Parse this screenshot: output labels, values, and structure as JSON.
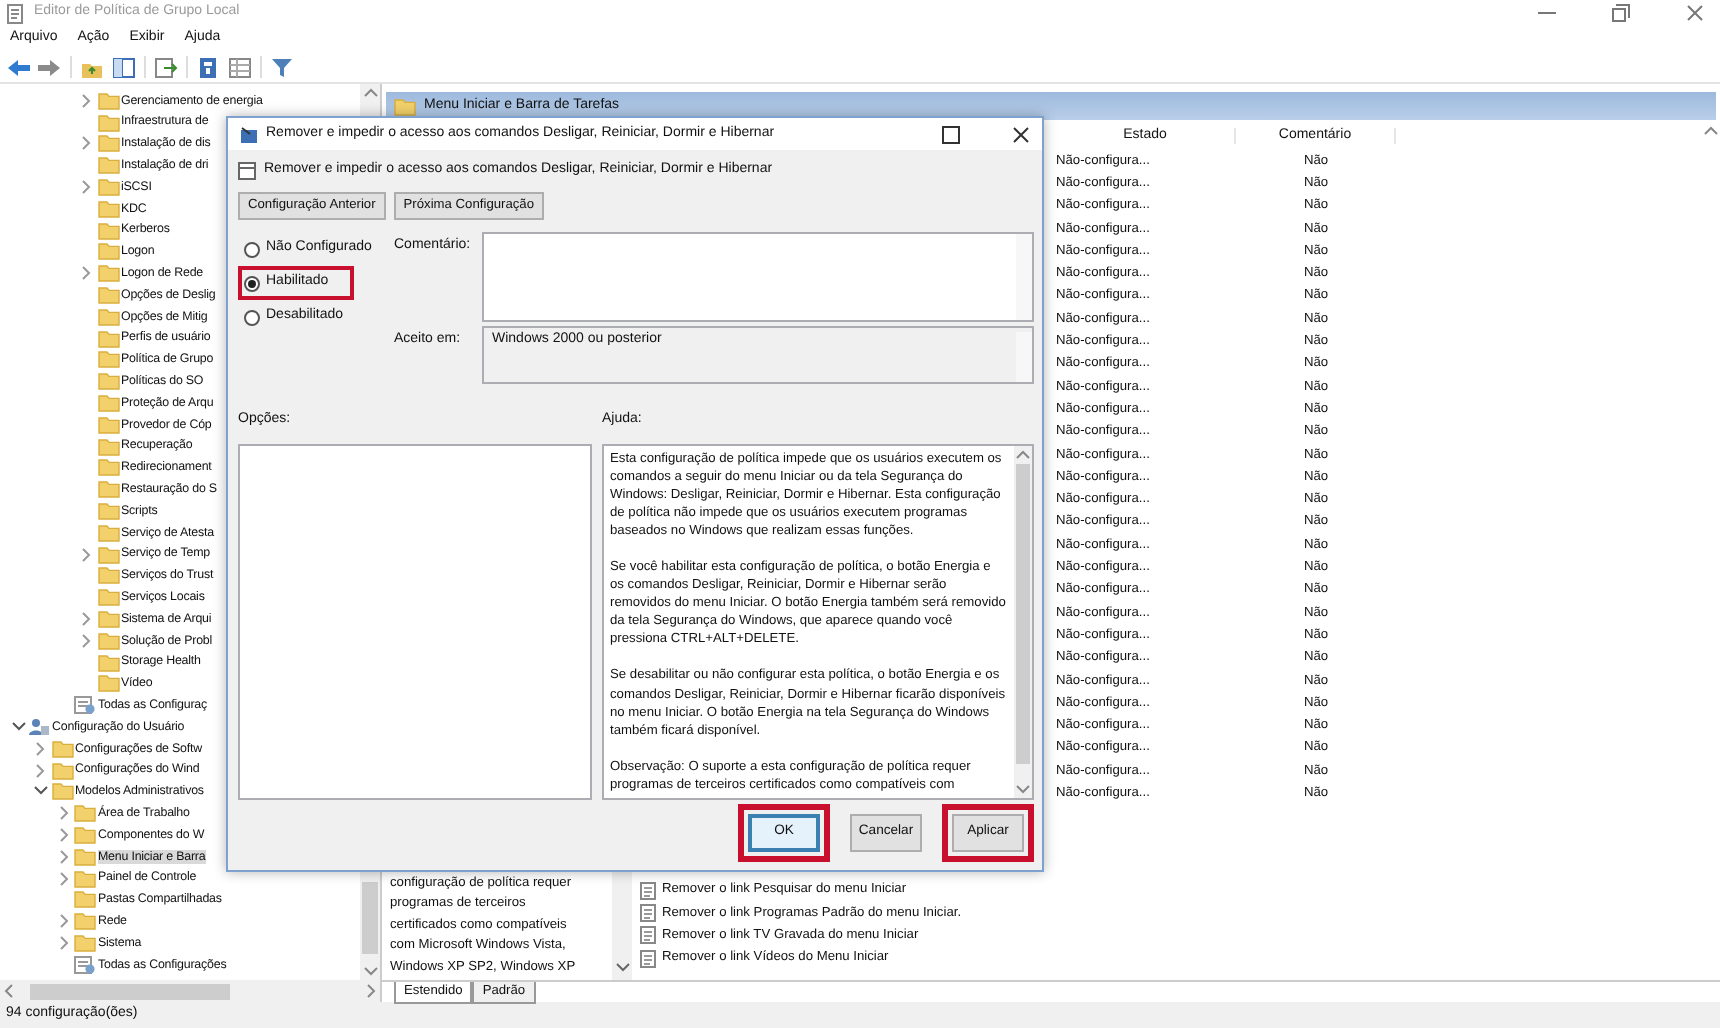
{
  "window": {
    "title": "Editor de Política de Grupo Local"
  },
  "menu": [
    "Arquivo",
    "Ação",
    "Exibir",
    "Ajuda"
  ],
  "tree": {
    "items": [
      {
        "children": [
          {
            "children": [
              {
                "children": [
                  {
                    "label": "Gerenciamento de energia",
                    "kind": "folder",
                    "expanded": false,
                    "selected": false
                  },
                  {
                    "label": "Infraestrutura de",
                    "kind": "folder",
                    "selected": false
                  },
                  {
                    "label": "Instalação de dis",
                    "kind": "folder",
                    "expanded": false,
                    "selected": false
                  },
                  {
                    "label": "Instalação de dri",
                    "kind": "folder",
                    "selected": false
                  },
                  {
                    "label": "iSCSI",
                    "kind": "folder",
                    "expanded": false,
                    "selected": false
                  },
                  {
                    "label": "KDC",
                    "kind": "folder",
                    "selected": false
                  },
                  {
                    "label": "Kerberos",
                    "kind": "folder",
                    "selected": false
                  },
                  {
                    "label": "Logon",
                    "kind": "folder",
                    "selected": false
                  },
                  {
                    "label": "Logon de Rede",
                    "kind": "folder",
                    "expanded": false,
                    "selected": false
                  },
                  {
                    "label": "Opções de Deslig",
                    "kind": "folder",
                    "selected": false
                  },
                  {
                    "label": "Opções de Mitig",
                    "kind": "folder",
                    "selected": false
                  },
                  {
                    "label": "Perfis de usuário",
                    "kind": "folder",
                    "selected": false
                  },
                  {
                    "label": "Política de Grupo",
                    "kind": "folder",
                    "selected": false
                  },
                  {
                    "label": "Políticas do SO",
                    "kind": "folder",
                    "selected": false
                  },
                  {
                    "label": "Proteção de Arqu",
                    "kind": "folder",
                    "selected": false
                  },
                  {
                    "label": "Provedor de Cóp",
                    "kind": "folder",
                    "selected": false
                  },
                  {
                    "label": "Recuperação",
                    "kind": "folder",
                    "selected": false
                  },
                  {
                    "label": "Redirecionament",
                    "kind": "folder",
                    "selected": false
                  },
                  {
                    "label": "Restauração do S",
                    "kind": "folder",
                    "selected": false
                  },
                  {
                    "label": "Scripts",
                    "kind": "folder",
                    "selected": false
                  },
                  {
                    "label": "Serviço de Atesta",
                    "kind": "folder",
                    "selected": false
                  },
                  {
                    "label": "Serviço de Temp",
                    "kind": "folder",
                    "expanded": false,
                    "selected": false
                  },
                  {
                    "label": "Serviços do Trust",
                    "kind": "folder",
                    "selected": false
                  },
                  {
                    "label": "Serviços Locais",
                    "kind": "folder",
                    "selected": false
                  },
                  {
                    "label": "Sistema de Arqui",
                    "kind": "folder",
                    "expanded": false,
                    "selected": false
                  },
                  {
                    "label": "Solução de Probl",
                    "kind": "folder",
                    "expanded": false,
                    "selected": false
                  },
                  {
                    "label": "Storage Health",
                    "kind": "folder",
                    "selected": false
                  },
                  {
                    "label": "Vídeo",
                    "kind": "folder",
                    "selected": false
                  }
                ]
              },
              {
                "label": "Todas as Configuraç",
                "kind": "settings",
                "selected": false
              }
            ]
          }
        ]
      },
      {
        "label": "Configuração do Usuário",
        "kind": "user",
        "expanded": true,
        "selected": false,
        "children": [
          {
            "label": "Configurações de Softw",
            "kind": "folder",
            "expanded": false,
            "selected": false
          },
          {
            "label": "Configurações do Wind",
            "kind": "folder",
            "expanded": false,
            "selected": false
          },
          {
            "label": "Modelos Administrativos",
            "kind": "folder",
            "expanded": true,
            "selected": false,
            "children": [
              {
                "label": "Área de Trabalho",
                "kind": "folder",
                "expanded": false,
                "selected": false
              },
              {
                "label": "Componentes do W",
                "kind": "folder",
                "expanded": false,
                "selected": false
              },
              {
                "label": "Menu Iniciar e Barra",
                "kind": "folder",
                "expanded": false,
                "selected": true
              },
              {
                "label": "Painel de Controle",
                "kind": "folder",
                "expanded": false,
                "selected": false
              },
              {
                "label": "Pastas Compartilhadas",
                "kind": "folder",
                "selected": false
              },
              {
                "label": "Rede",
                "kind": "folder",
                "expanded": false,
                "selected": false
              },
              {
                "label": "Sistema",
                "kind": "folder",
                "expanded": false,
                "selected": false
              },
              {
                "label": "Todas as Configurações",
                "kind": "settings",
                "selected": false
              }
            ]
          }
        ]
      }
    ]
  },
  "details": {
    "header": "Menu Iniciar e Barra de Tarefas",
    "description_lines": [
      "configuração de política requer",
      "programas de terceiros",
      "certificados como compatíveis",
      "com Microsoft Windows Vista,",
      "Windows XP SP2, Windows XP"
    ],
    "tabs": [
      {
        "label": "Estendido",
        "selected": true
      },
      {
        "label": "Padrão",
        "selected": false
      }
    ]
  },
  "list": {
    "columns": [
      "Estado",
      "Comentário"
    ],
    "rows": [
      {
        "estado": "Não-configura...",
        "comentario": "Não"
      },
      {
        "estado": "Não-configura...",
        "comentario": "Não"
      },
      {
        "estado": "Não-configura...",
        "comentario": "Não"
      },
      {
        "estado": "Não-configura...",
        "comentario": "Não"
      },
      {
        "estado": "Não-configura...",
        "comentario": "Não"
      },
      {
        "estado": "Não-configura...",
        "comentario": "Não"
      },
      {
        "estado": "Não-configura...",
        "comentario": "Não"
      },
      {
        "estado": "Não-configura...",
        "comentario": "Não"
      },
      {
        "estado": "Não-configura...",
        "comentario": "Não"
      },
      {
        "estado": "Não-configura...",
        "comentario": "Não"
      },
      {
        "estado": "Não-configura...",
        "comentario": "Não"
      },
      {
        "estado": "Não-configura...",
        "comentario": "Não"
      },
      {
        "estado": "Não-configura...",
        "comentario": "Não"
      },
      {
        "estado": "Não-configura...",
        "comentario": "Não"
      },
      {
        "estado": "Não-configura...",
        "comentario": "Não"
      },
      {
        "estado": "Não-configura...",
        "comentario": "Não"
      },
      {
        "estado": "Não-configura...",
        "comentario": "Não"
      },
      {
        "estado": "Não-configura...",
        "comentario": "Não"
      },
      {
        "estado": "Não-configura...",
        "comentario": "Não"
      },
      {
        "estado": "Não-configura...",
        "comentario": "Não"
      },
      {
        "estado": "Não-configura...",
        "comentario": "Não"
      },
      {
        "estado": "Não-configura...",
        "comentario": "Não"
      },
      {
        "estado": "Não-configura...",
        "comentario": "Não"
      },
      {
        "estado": "Não-configura...",
        "comentario": "Não"
      },
      {
        "estado": "Não-configura...",
        "comentario": "Não"
      },
      {
        "estado": "Não-configura...",
        "comentario": "Não"
      },
      {
        "estado": "Não-configura...",
        "comentario": "Não"
      },
      {
        "estado": "Não-configura...",
        "comentario": "Não"
      },
      {
        "estado": "Não-configura...",
        "comentario": "Não"
      }
    ],
    "lower_rows": [
      {
        "name": "Remover o link Pesquisar do menu Iniciar"
      },
      {
        "name": "Remover o link Programas Padrão do menu Iniciar."
      },
      {
        "name": "Remover o link TV Gravada do menu Iniciar"
      },
      {
        "name": "Remover o link Vídeos do Menu Iniciar"
      }
    ]
  },
  "status_bar": "94 configuração(ões)",
  "dialog": {
    "title": "Remover e impedir o acesso aos comandos Desligar, Reiniciar, Dormir e Hibernar",
    "heading": "Remover e impedir o acesso aos comandos Desligar, Reiniciar, Dormir e Hibernar",
    "nav_buttons": [
      "Configuração Anterior",
      "Próxima Configuração"
    ],
    "options": [
      {
        "label": "Não Configurado",
        "selected": false,
        "highlighted": false
      },
      {
        "label": "Habilitado",
        "selected": true,
        "highlighted": true
      },
      {
        "label": "Desabilitado",
        "selected": false,
        "highlighted": false
      }
    ],
    "comment_label": "Comentário:",
    "supported_label": "Aceito em:",
    "supported_value": "Windows 2000 ou posterior",
    "options_label": "Opções:",
    "help_label": "Ajuda:",
    "help_paragraphs": [
      "Esta configuração de política impede que os usuários executem os comandos a seguir do menu Iniciar ou da tela Segurança do Windows: Desligar, Reiniciar, Dormir e Hibernar. Esta configuração de política não impede que os usuários executem programas baseados no Windows que realizam essas funções.",
      "Se você habilitar esta configuração de política, o botão Energia e os comandos Desligar, Reiniciar, Dormir e Hibernar serão removidos do menu Iniciar. O botão Energia também será removido da tela Segurança do Windows, que aparece quando você pressiona CTRL+ALT+DELETE.",
      "Se desabilitar ou não configurar esta política, o botão Energia e os comandos Desligar, Reiniciar, Dormir e Hibernar ficarão disponíveis no menu Iniciar. O botão Energia na tela Segurança do Windows também ficará disponível.",
      "Observação: O suporte a esta configuração de política requer programas de terceiros certificados como compatíveis com"
    ],
    "buttons": [
      {
        "label": "OK",
        "default": true,
        "highlighted": true
      },
      {
        "label": "Cancelar",
        "default": false,
        "highlighted": false
      },
      {
        "label": "Aplicar",
        "default": false,
        "highlighted": true
      }
    ]
  }
}
